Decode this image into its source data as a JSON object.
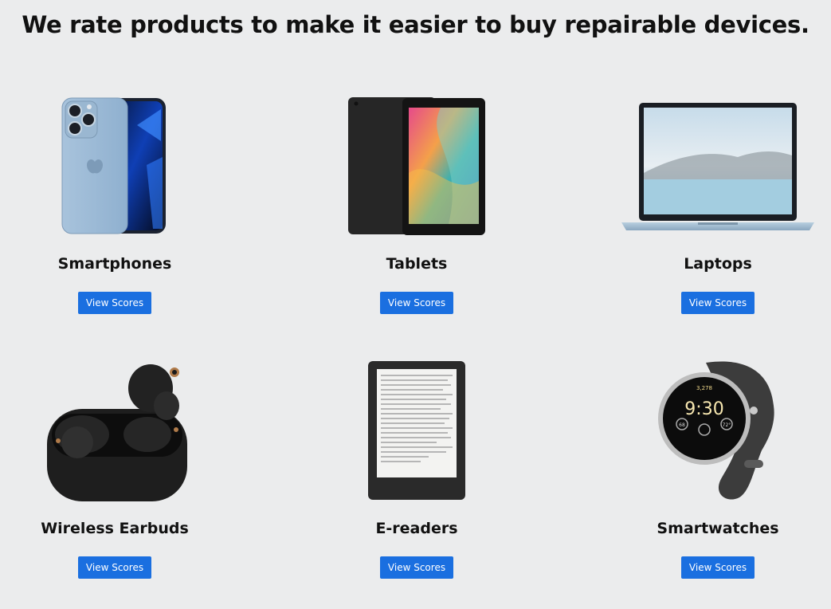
{
  "headline": "We rate products to make it easier to buy repairable devices.",
  "categories": [
    {
      "name": "Smartphones",
      "button": "View Scores",
      "icon": "smartphone-image"
    },
    {
      "name": "Tablets",
      "button": "View Scores",
      "icon": "tablet-image"
    },
    {
      "name": "Laptops",
      "button": "View Scores",
      "icon": "laptop-image"
    },
    {
      "name": "Wireless Earbuds",
      "button": "View Scores",
      "icon": "earbuds-image"
    },
    {
      "name": "E-readers",
      "button": "View Scores",
      "icon": "ereader-image"
    },
    {
      "name": "Smartwatches",
      "button": "View Scores",
      "icon": "smartwatch-image"
    }
  ],
  "watch_face": {
    "time": "9:30",
    "steps": "3,278",
    "temp": "72°",
    "hr": "68"
  },
  "colors": {
    "button": "#1a6fe0",
    "background": "#ebeced"
  }
}
